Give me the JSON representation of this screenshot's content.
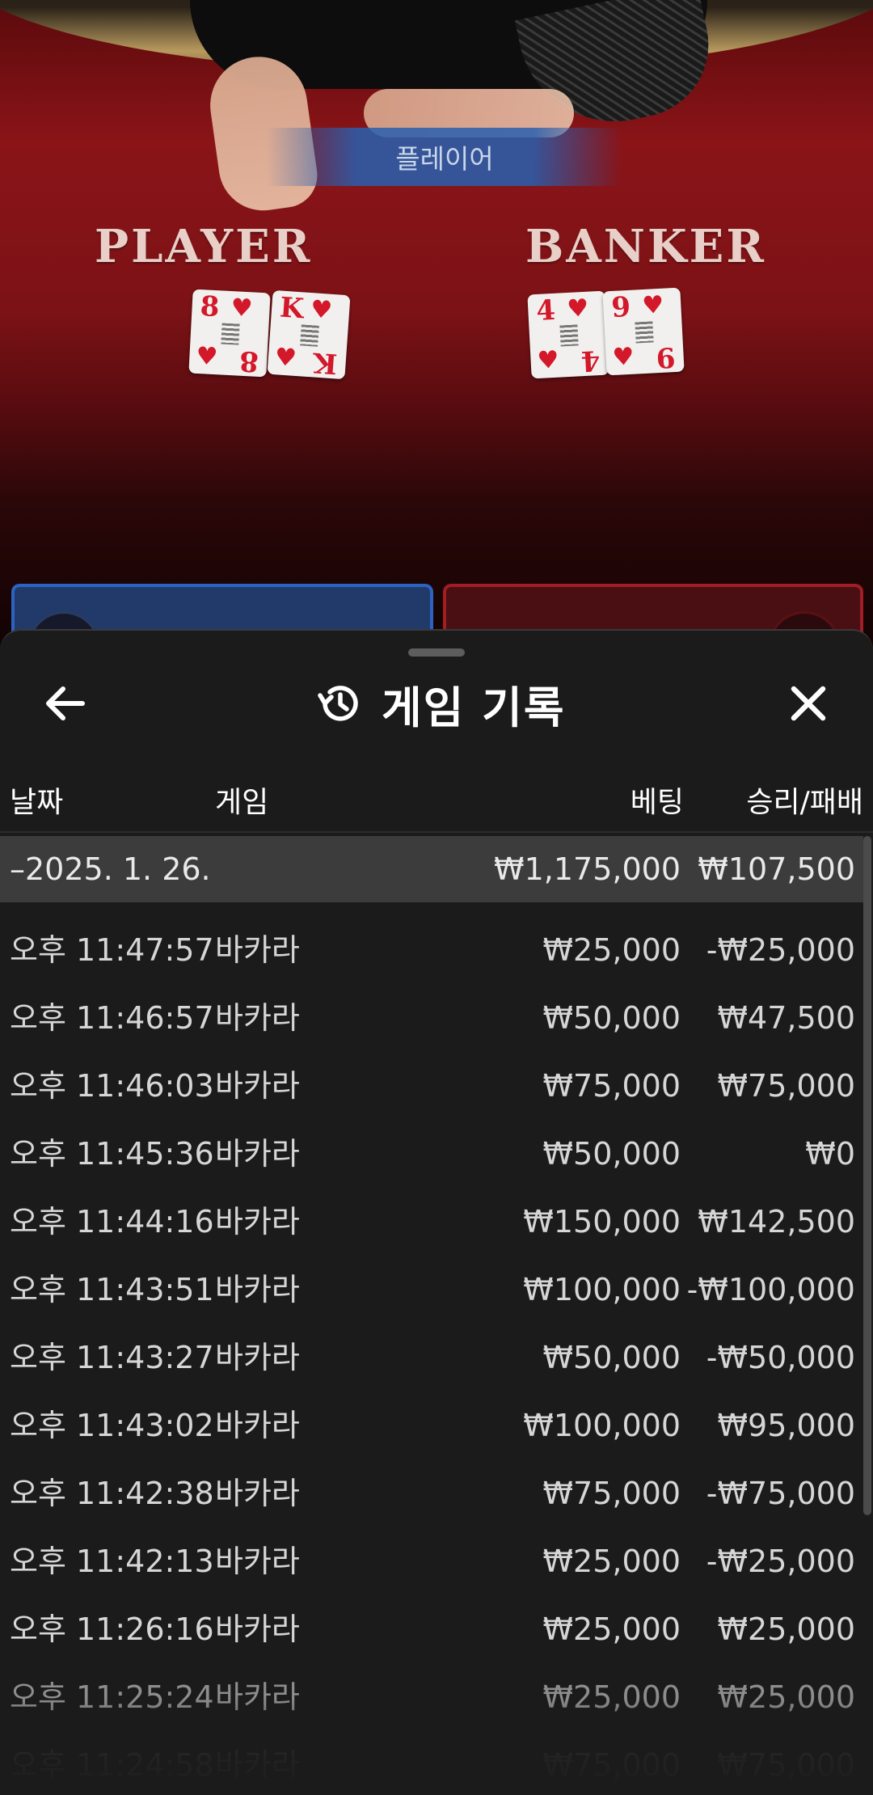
{
  "game_view": {
    "result_banner": "플레이어",
    "player_label": "PLAYER",
    "banker_label": "BANKER",
    "player_cards": [
      {
        "rank": "8",
        "suit": "♥"
      },
      {
        "rank": "K",
        "suit": "♥"
      }
    ],
    "banker_cards": [
      {
        "rank": "4",
        "suit": "♥"
      },
      {
        "rank": "9",
        "suit": "♥"
      }
    ]
  },
  "history": {
    "title": "게임 기록",
    "icons": {
      "back": "arrow-left-icon",
      "title": "history-icon",
      "close": "close-icon"
    },
    "columns": {
      "date": "날짜",
      "game": "게임",
      "bet": "베팅",
      "win_loss": "승리/패배"
    },
    "date_group": {
      "label": "–2025. 1. 26.",
      "bet_total": "₩1,175,000",
      "win_total": "₩107,500"
    },
    "rows": [
      {
        "time": "오후 11:47:57",
        "game": "바카라",
        "bet": "₩25,000",
        "win": "-₩25,000"
      },
      {
        "time": "오후 11:46:57",
        "game": "바카라",
        "bet": "₩50,000",
        "win": "₩47,500"
      },
      {
        "time": "오후 11:46:03",
        "game": "바카라",
        "bet": "₩75,000",
        "win": "₩75,000"
      },
      {
        "time": "오후 11:45:36",
        "game": "바카라",
        "bet": "₩50,000",
        "win": "₩0"
      },
      {
        "time": "오후 11:44:16",
        "game": "바카라",
        "bet": "₩150,000",
        "win": "₩142,500"
      },
      {
        "time": "오후 11:43:51",
        "game": "바카라",
        "bet": "₩100,000",
        "win": "-₩100,000"
      },
      {
        "time": "오후 11:43:27",
        "game": "바카라",
        "bet": "₩50,000",
        "win": "-₩50,000"
      },
      {
        "time": "오후 11:43:02",
        "game": "바카라",
        "bet": "₩100,000",
        "win": "₩95,000"
      },
      {
        "time": "오후 11:42:38",
        "game": "바카라",
        "bet": "₩75,000",
        "win": "-₩75,000"
      },
      {
        "time": "오후 11:42:13",
        "game": "바카라",
        "bet": "₩25,000",
        "win": "-₩25,000"
      },
      {
        "time": "오후 11:26:16",
        "game": "바카라",
        "bet": "₩25,000",
        "win": "₩25,000"
      },
      {
        "time": "오후 11:25:24",
        "game": "바카라",
        "bet": "₩25,000",
        "win": "₩25,000"
      },
      {
        "time": "오후 11:24:58",
        "game": "바카라",
        "bet": "₩75,000",
        "win": "₩75,000"
      }
    ]
  }
}
